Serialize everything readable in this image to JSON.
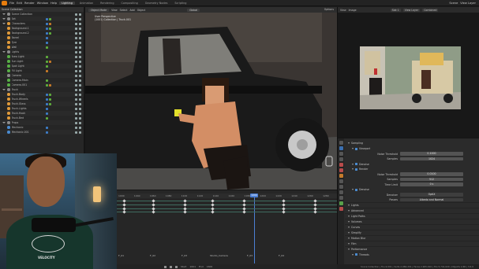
{
  "menubar": {
    "items": [
      "File",
      "Edit",
      "Render",
      "Window",
      "Help"
    ],
    "workspaces": [
      "Lighting",
      "Animation",
      "Rendering",
      "Compositing",
      "Geometry Nodes",
      "Scripting"
    ],
    "active_workspace": "Lighting",
    "scene": "Scene",
    "view_layer": "View Layer"
  },
  "outliner": {
    "header": "Scene Collection",
    "rows": [
      {
        "label": "Scene Collection",
        "icon": "collection",
        "color": "gray",
        "mods": []
      },
      {
        "label": "Set",
        "icon": "collection",
        "color": "gray",
        "mods": [
          "b",
          "g"
        ]
      },
      {
        "label": "Characters",
        "icon": "collection",
        "color": "orange",
        "mods": [
          "b",
          "o"
        ]
      },
      {
        "label": "Background-1",
        "icon": "object",
        "color": "orange",
        "mods": [
          "b",
          "g"
        ]
      },
      {
        "label": "Background-2",
        "icon": "object",
        "color": "orange",
        "mods": [
          "b",
          "g"
        ]
      },
      {
        "label": "Barrel",
        "icon": "object",
        "color": "orange",
        "mods": [
          "b"
        ]
      },
      {
        "label": "Tyre",
        "icon": "object",
        "color": "orange",
        "mods": [
          "b"
        ]
      },
      {
        "label": "Wall",
        "icon": "object",
        "color": "orange",
        "mods": [
          "g"
        ]
      },
      {
        "label": "Lights",
        "icon": "collection",
        "color": "gray",
        "mods": []
      },
      {
        "label": "Area Light",
        "icon": "light",
        "color": "green",
        "mods": [
          "g"
        ]
      },
      {
        "label": "Sun Light",
        "icon": "light",
        "color": "green",
        "mods": [
          "g",
          "o"
        ]
      },
      {
        "label": "Spot Light",
        "icon": "light",
        "color": "green",
        "mods": [
          "g"
        ]
      },
      {
        "label": "Fill Light",
        "icon": "light",
        "color": "green",
        "mods": [
          "o"
        ]
      },
      {
        "label": "Camera",
        "icon": "camera",
        "color": "gray",
        "mods": []
      },
      {
        "label": "Camera.Main",
        "icon": "camera",
        "color": "green",
        "mods": [
          "g"
        ]
      },
      {
        "label": "Camera.001",
        "icon": "camera",
        "color": "green",
        "mods": [
          "g",
          "o"
        ]
      },
      {
        "label": "Truck",
        "icon": "collection",
        "color": "gray",
        "mods": []
      },
      {
        "label": "Truck.Body",
        "icon": "object",
        "color": "orange",
        "mods": [
          "b",
          "g"
        ]
      },
      {
        "label": "Truck.Wheels",
        "icon": "object",
        "color": "orange",
        "mods": [
          "b",
          "g"
        ]
      },
      {
        "label": "Truck.Glass",
        "icon": "object",
        "color": "orange",
        "mods": [
          "b",
          "g"
        ]
      },
      {
        "label": "Truck.Lights",
        "icon": "object",
        "color": "orange",
        "mods": [
          "b"
        ]
      },
      {
        "label": "Truck.Hook",
        "icon": "object",
        "color": "orange",
        "mods": [
          "b"
        ]
      },
      {
        "label": "Truck.Bed",
        "icon": "object",
        "color": "orange",
        "mods": [
          "g"
        ]
      },
      {
        "label": "Props",
        "icon": "collection",
        "color": "gray",
        "mods": []
      },
      {
        "label": "Mechanic",
        "icon": "armature",
        "color": "blue",
        "mods": [
          "b"
        ]
      },
      {
        "label": "Mechanic.001",
        "icon": "armature",
        "color": "blue",
        "mods": [
          "b"
        ]
      }
    ]
  },
  "viewport": {
    "header": {
      "mode": "Object Mode",
      "items": [
        "View",
        "Select",
        "Add",
        "Object"
      ],
      "shading": "Global",
      "options": "Options"
    },
    "info_line1": "User Perspective",
    "info_line2": "(1001) Collection | Truck.001"
  },
  "webcam": {
    "shirt_text": "VELOCITY"
  },
  "right_top": {
    "header": {
      "items": [
        "View",
        "Image"
      ],
      "slot": "Slot 1",
      "layer": "View Layer",
      "pass": "Combined"
    }
  },
  "timeline": {
    "ruler_labels": [
      "1000",
      "1040",
      "1060",
      "1080",
      "1100",
      "1120",
      "1140",
      "1160",
      "1180",
      "1200",
      "1220",
      "1240",
      "1260",
      "1280"
    ],
    "current_frame": "1000",
    "markers": [
      "F_01",
      "F_02",
      "F_03",
      "Studio_Camera",
      "F_03",
      "F_04"
    ],
    "footer": [
      "Start",
      "1001",
      "End",
      "1600"
    ]
  },
  "properties": {
    "rows": [
      {
        "type": "panel",
        "label": "Sampling",
        "value": ""
      },
      {
        "type": "sub",
        "label": "Viewport",
        "value": ""
      },
      {
        "type": "field",
        "label": "Noise Threshold",
        "value": "0.1000"
      },
      {
        "type": "field",
        "label": "Samples",
        "value": "1024"
      },
      {
        "type": "sub",
        "label": "Denoise",
        "value": ""
      },
      {
        "type": "sub",
        "label": "Render",
        "value": ""
      },
      {
        "type": "field",
        "label": "Noise Threshold",
        "value": "0.0100"
      },
      {
        "type": "field",
        "label": "Samples",
        "value": "512"
      },
      {
        "type": "field",
        "label": "Time Limit",
        "value": "0 s"
      },
      {
        "type": "sub",
        "label": "Denoise",
        "value": ""
      },
      {
        "type": "field",
        "label": "Denoiser",
        "value": "OptiX"
      },
      {
        "type": "field",
        "label": "Passes",
        "value": "Albedo and Normal"
      },
      {
        "type": "panel",
        "label": "Lights",
        "value": ""
      },
      {
        "type": "panel",
        "label": "Advanced",
        "value": ""
      },
      {
        "type": "panel",
        "label": "Light Paths",
        "value": ""
      },
      {
        "type": "panel",
        "label": "Volumes",
        "value": ""
      },
      {
        "type": "panel",
        "label": "Curves",
        "value": ""
      },
      {
        "type": "panel",
        "label": "Simplify",
        "value": ""
      },
      {
        "type": "panel",
        "label": "Motion Blur",
        "value": ""
      },
      {
        "type": "panel",
        "label": "Film",
        "value": ""
      },
      {
        "type": "panel",
        "label": "Performance",
        "value": ""
      },
      {
        "type": "sub",
        "label": "Threads",
        "value": ""
      }
    ]
  },
  "statusbar": {
    "text": "Scene Collection | Truck.001 | Verts 2,984,201 | Faces 2,905,610 | Tris 5,741,020 | Objects 1/96 | 3.6.0"
  },
  "colors": {
    "accent": "#e87d0d",
    "selection": "#4c7fd4",
    "track": "#3f6b5f"
  }
}
